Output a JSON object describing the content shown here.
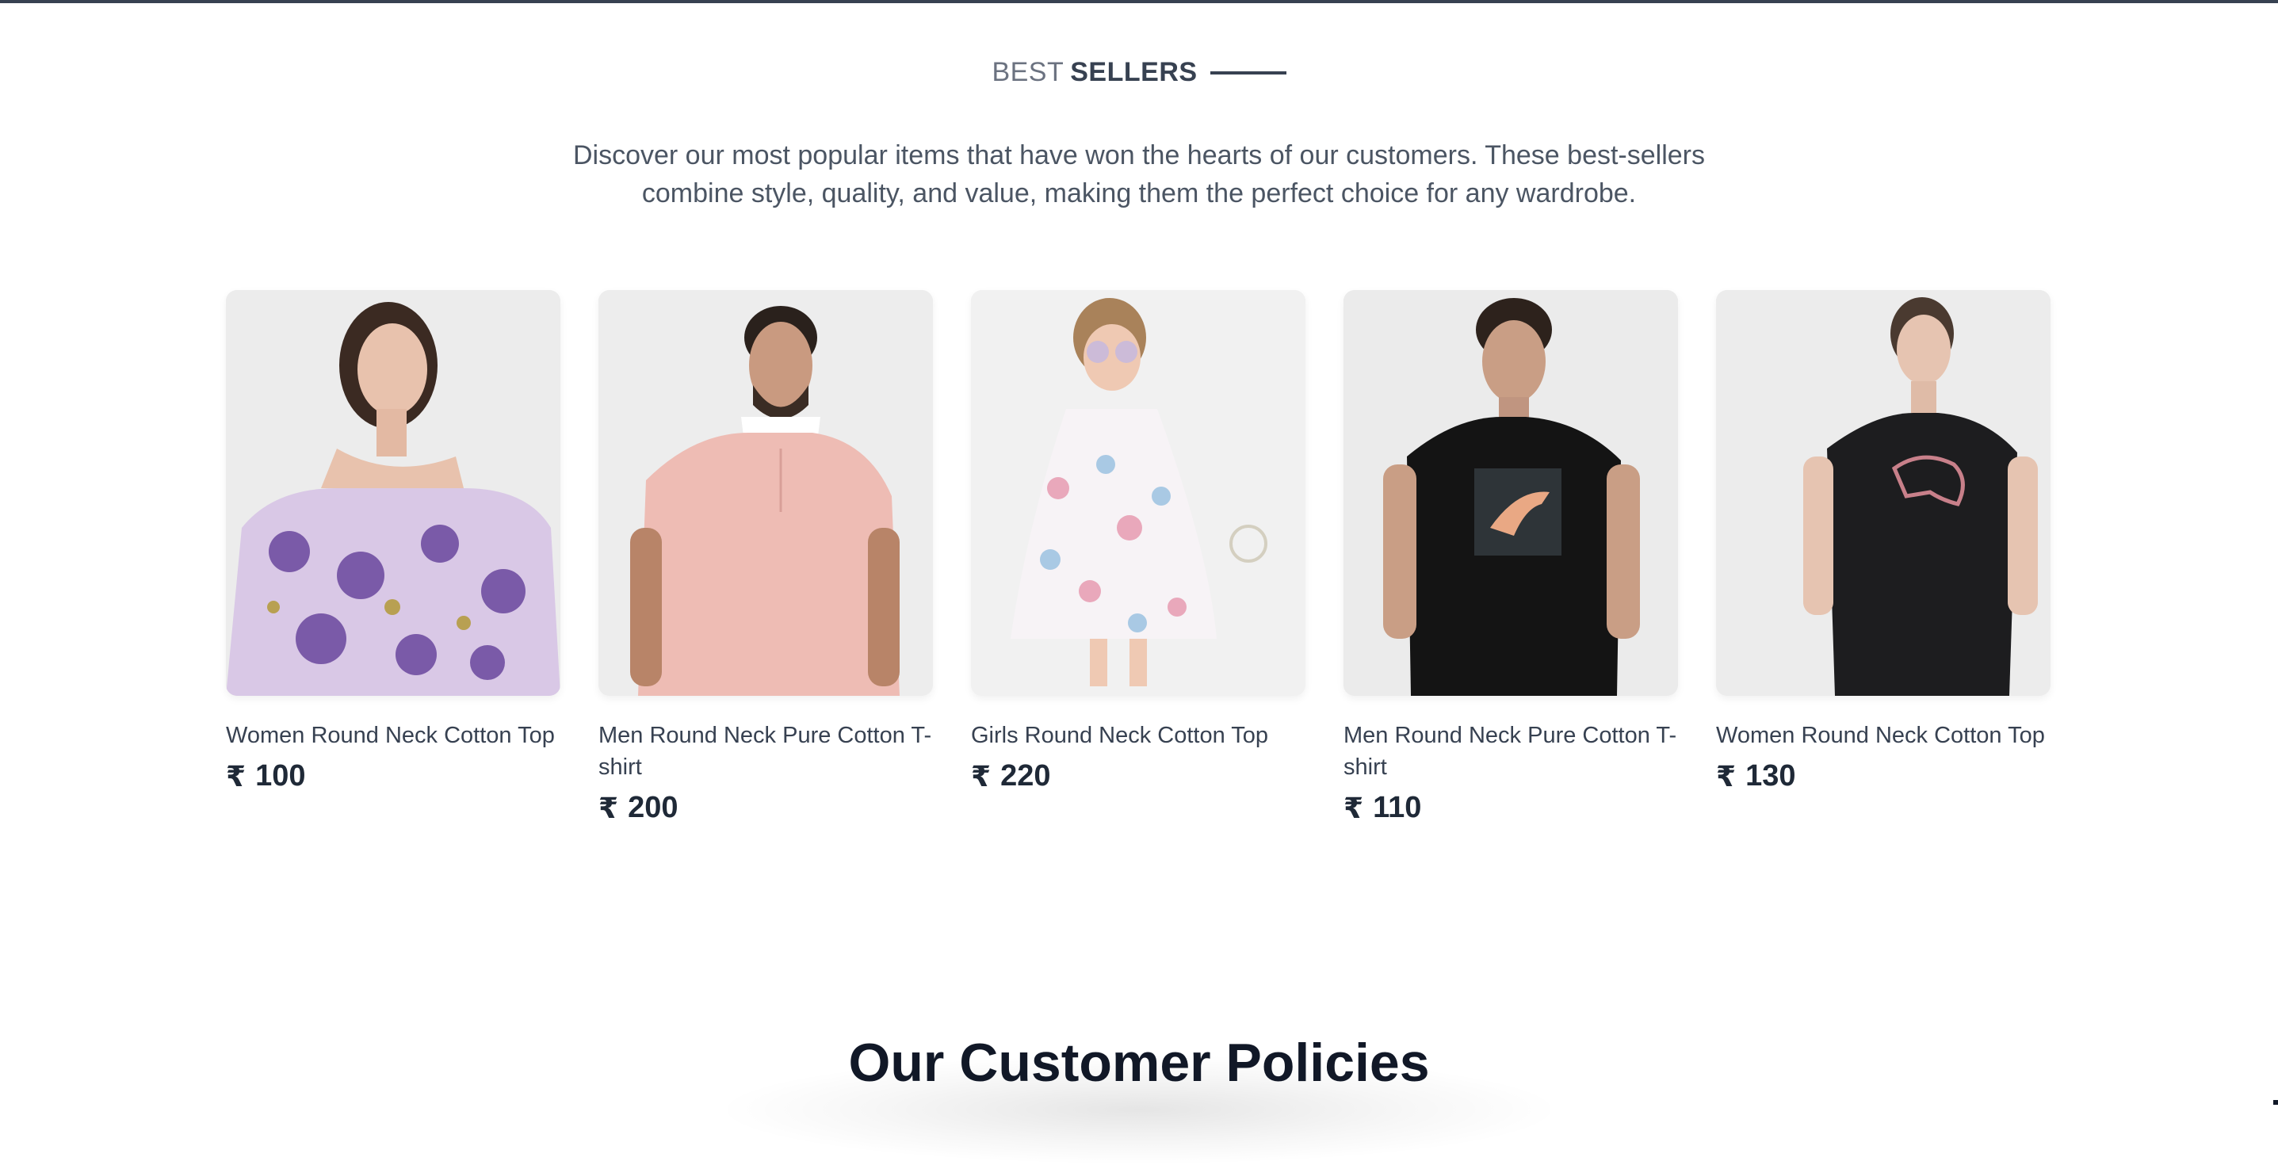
{
  "header": {
    "title_light": "BEST",
    "title_bold": "SELLERS"
  },
  "intro": {
    "text": "Discover our most popular items that have won the hearts of our customers. These best-sellers combine style, quality, and value, making them the perfect choice for any wardrobe."
  },
  "currency_symbol": "₹",
  "products": [
    {
      "name": "Women Round Neck Cotton Top",
      "price": "100",
      "image_icon": "woman-floral-top-photo"
    },
    {
      "name": "Men Round Neck Pure Cotton T-shirt",
      "price": "200",
      "image_icon": "man-pink-polo-photo"
    },
    {
      "name": "Girls Round Neck Cotton Top",
      "price": "220",
      "image_icon": "girl-floral-dress-photo"
    },
    {
      "name": "Men Round Neck Pure Cotton T-shirt",
      "price": "110",
      "image_icon": "man-black-tshirt-photo"
    },
    {
      "name": "Women Round Neck Cotton Top",
      "price": "130",
      "image_icon": "woman-black-tshirt-photo"
    }
  ],
  "policies": {
    "title": "Our Customer Policies"
  },
  "colors": {
    "text_dark": "#1f2937",
    "text_muted": "#6b7280",
    "card_bg": "#efefef"
  }
}
